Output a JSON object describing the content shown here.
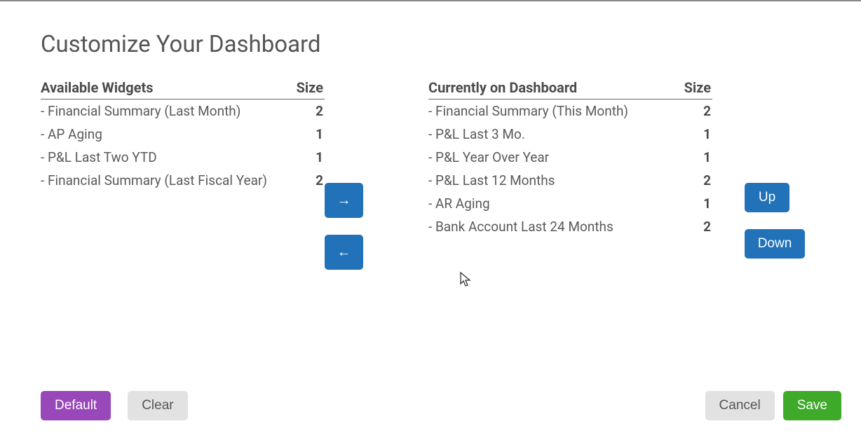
{
  "title": "Customize Your Dashboard",
  "headers": {
    "available": "Available Widgets",
    "current": "Currently on Dashboard",
    "size": "Size"
  },
  "available": [
    {
      "name": "Financial Summary (Last Month)",
      "size": "2"
    },
    {
      "name": "AP Aging",
      "size": "1"
    },
    {
      "name": "P&L Last Two YTD",
      "size": "1"
    },
    {
      "name": "Financial Summary (Last Fiscal Year)",
      "size": "2"
    }
  ],
  "current": [
    {
      "name": "Financial Summary (This Month)",
      "size": "2"
    },
    {
      "name": "P&L Last 3 Mo.",
      "size": "1"
    },
    {
      "name": "P&L Year Over Year",
      "size": "1"
    },
    {
      "name": "P&L Last 12 Months",
      "size": "2"
    },
    {
      "name": "AR Aging",
      "size": "1"
    },
    {
      "name": "Bank Account Last 24 Months",
      "size": "2"
    }
  ],
  "buttons": {
    "right_arrow": "→",
    "left_arrow": "←",
    "up": "Up",
    "down": "Down",
    "default": "Default",
    "clear": "Clear",
    "cancel": "Cancel",
    "save": "Save"
  }
}
